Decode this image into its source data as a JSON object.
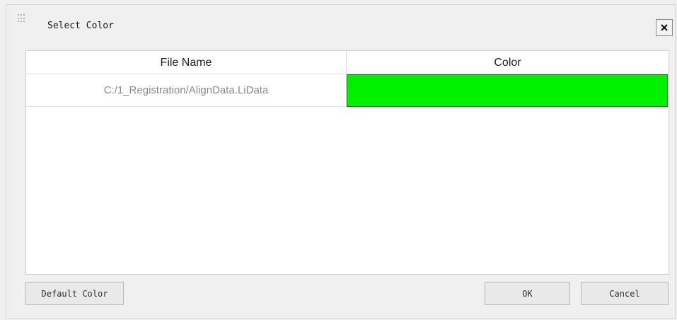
{
  "dialog": {
    "title": "Select Color",
    "close_icon": "close-icon"
  },
  "table": {
    "columns": [
      "File Name",
      "Color"
    ],
    "rows": [
      {
        "file_name": "C:/1_Registration/AlignData.LiData",
        "color": "#00f000"
      }
    ]
  },
  "buttons": {
    "default_color": "Default Color",
    "ok": "OK",
    "cancel": "Cancel"
  }
}
